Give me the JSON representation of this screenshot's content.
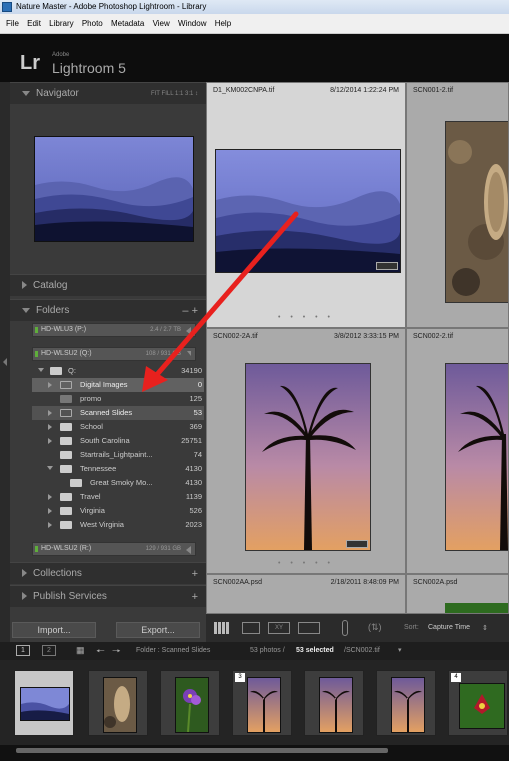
{
  "window": {
    "title": "Nature Master - Adobe Photoshop Lightroom - Library"
  },
  "menu": [
    "File",
    "Edit",
    "Library",
    "Photo",
    "Metadata",
    "View",
    "Window",
    "Help"
  ],
  "identity": {
    "logo": "Lr",
    "adobe": "Adobe",
    "app": "Lightroom 5"
  },
  "navigator": {
    "label": "Navigator",
    "options": "FIT  FILL  1:1  3:1 ↕"
  },
  "catalog": {
    "label": "Catalog"
  },
  "folders": {
    "label": "Folders",
    "drives": [
      {
        "name": "HD-WLU3 (P:)",
        "info": "2.4 / 2.7 TB"
      },
      {
        "name": "HD-WLSU2 (Q:)",
        "info": "108 / 931 GB"
      },
      {
        "name": "HD-WLSU2 (R:)",
        "info": "129 / 931 GB"
      }
    ],
    "root": {
      "name": "Q:",
      "count": "34190"
    },
    "items": [
      {
        "name": "Digital Images",
        "count": "0"
      },
      {
        "name": "promo",
        "count": "125"
      },
      {
        "name": "Scanned Slides",
        "count": "53"
      },
      {
        "name": "School",
        "count": "369"
      },
      {
        "name": "South Carolina",
        "count": "25751"
      },
      {
        "name": "Startrails_Lightpaint...",
        "count": "74"
      },
      {
        "name": "Tennessee",
        "count": "4130"
      },
      {
        "name": "Great Smoky Mo...",
        "count": "4130"
      },
      {
        "name": "Travel",
        "count": "1139"
      },
      {
        "name": "Virginia",
        "count": "526"
      },
      {
        "name": "West Virginia",
        "count": "2023"
      }
    ]
  },
  "collections": {
    "label": "Collections"
  },
  "publish": {
    "label": "Publish Services"
  },
  "buttons": {
    "import": "Import...",
    "export": "Export..."
  },
  "grid": {
    "cells": [
      {
        "name": "D1_KM002CNPA.tif",
        "date": "8/12/2014 1:22:24 PM"
      },
      {
        "name": "SCN001-2.tif",
        "date": ""
      },
      {
        "name": "SCN002-2A.tif",
        "date": "3/8/2012 3:33:15 PM"
      },
      {
        "name": "SCN002-2.tif",
        "date": ""
      },
      {
        "name": "SCN002AA.psd",
        "date": "2/18/2011 8:48:09 PM"
      },
      {
        "name": "SCN002A.psd",
        "date": ""
      }
    ]
  },
  "toolbar": {
    "sort_label": "Sort:",
    "sort_value": "Capture Time"
  },
  "filmbar": {
    "screen1": "1",
    "screen2": "2",
    "source": "Folder : Scanned Slides",
    "count": "53 photos /",
    "selected": "53 selected",
    "file": "/SCN002.tif"
  },
  "filmstrip": {
    "badges": [
      "3",
      "4"
    ]
  },
  "colors": {
    "accent_arrow": "#e8211e",
    "selection": "#d6d6d6"
  }
}
